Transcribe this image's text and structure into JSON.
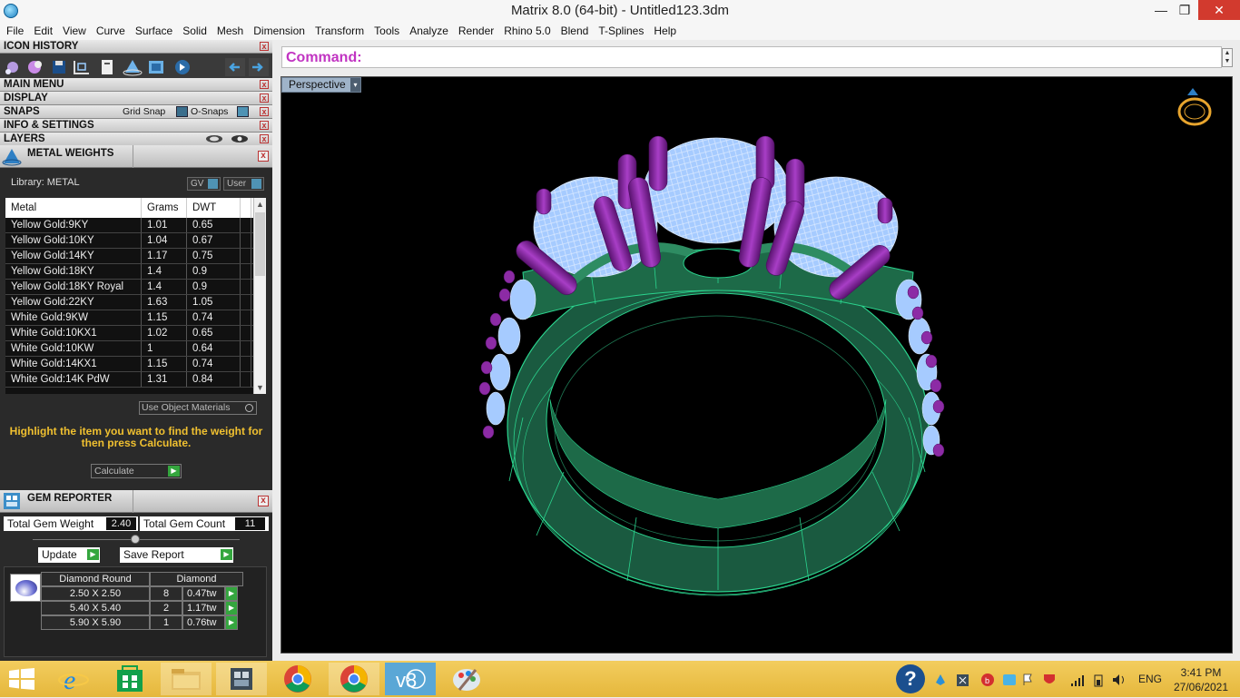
{
  "window": {
    "title": "Matrix 8.0 (64-bit) - Untitled123.3dm",
    "controls": {
      "minimize": "—",
      "restore": "❐",
      "close": "✕"
    }
  },
  "menu": [
    "File",
    "Edit",
    "View",
    "Curve",
    "Surface",
    "Solid",
    "Mesh",
    "Dimension",
    "Transform",
    "Tools",
    "Analyze",
    "Render",
    "Rhino 5.0",
    "Blend",
    "T-Splines",
    "Help"
  ],
  "sections": {
    "icon_history": "ICON HISTORY",
    "main_menu": "MAIN MENU",
    "display": "DISPLAY",
    "snaps": "SNAPS",
    "grid_snap": "Grid Snap",
    "o_snaps": "O-Snaps",
    "info_settings": "INFO & SETTINGS",
    "layers": "LAYERS",
    "close_glyph": "x"
  },
  "metal_weights": {
    "title": "METAL WEIGHTS",
    "library_label": "Library: METAL",
    "gv_label": "GV",
    "user_label": "User",
    "columns": [
      "Metal",
      "Grams",
      "DWT"
    ],
    "rows": [
      [
        "Yellow Gold:9KY",
        "1.01",
        "0.65"
      ],
      [
        "Yellow Gold:10KY",
        "1.04",
        "0.67"
      ],
      [
        "Yellow Gold:14KY",
        "1.17",
        "0.75"
      ],
      [
        "Yellow Gold:18KY",
        "1.4",
        "0.9"
      ],
      [
        "Yellow Gold:18KY Royal",
        "1.4",
        "0.9"
      ],
      [
        "Yellow Gold:22KY",
        "1.63",
        "1.05"
      ],
      [
        "White Gold:9KW",
        "1.15",
        "0.74"
      ],
      [
        "White Gold:10KX1",
        "1.02",
        "0.65"
      ],
      [
        "White Gold:10KW",
        "1",
        "0.64"
      ],
      [
        "White Gold:14KX1",
        "1.15",
        "0.74"
      ],
      [
        "White Gold:14K PdW",
        "1.31",
        "0.84"
      ]
    ],
    "use_object_materials": "Use Object Materials",
    "hint": "Highlight the item you want to find the weight for then press Calculate.",
    "calculate": "Calculate"
  },
  "gem_reporter": {
    "title": "GEM REPORTER",
    "total_weight_label": "Total Gem Weight",
    "total_weight": "2.40",
    "total_count_label": "Total Gem Count",
    "total_count": "11",
    "update": "Update",
    "save_report": "Save Report",
    "table_head": [
      "Diamond Round",
      "Diamond"
    ],
    "rows": [
      [
        "2.50 X 2.50",
        "8",
        "0.47tw"
      ],
      [
        "5.40 X 5.40",
        "2",
        "1.17tw"
      ],
      [
        "5.90 X 5.90",
        "1",
        "0.76tw"
      ]
    ],
    "go_glyph": "▶"
  },
  "command": {
    "label": "Command:"
  },
  "viewport": {
    "name": "Perspective",
    "dropdown_glyph": "▾"
  },
  "taskbar": {
    "language": "ENG",
    "time": "3:41 PM",
    "date": "27/06/2021",
    "help_glyph": "?"
  },
  "colors": {
    "ring_band": "#1f6b4b",
    "ring_wire": "#2bd48e",
    "stone": "#a6cbff",
    "prong": "#8c2ba5",
    "command": "#c134c2",
    "hint": "#f0c030",
    "taskbar": "#e5b73c"
  }
}
